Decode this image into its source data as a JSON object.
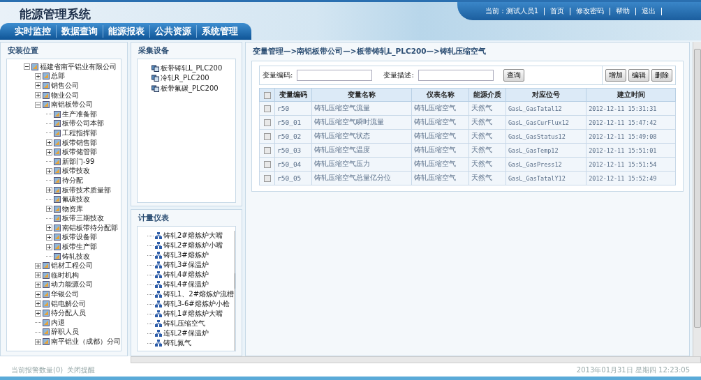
{
  "header": {
    "title": "能源管理系统",
    "user_label": "当前：",
    "user": "测试人员1",
    "links": [
      "首页",
      "修改密码",
      "帮助",
      "退出"
    ],
    "nav": [
      "实时监控",
      "数据查询",
      "能源报表",
      "公共资源",
      "系统管理"
    ]
  },
  "location_panel": {
    "title": "安装位置",
    "tree": [
      {
        "label": "福建省南平铝业有限公司",
        "kind": "branch",
        "expanded": true,
        "children": [
          {
            "label": "总部",
            "kind": "branch",
            "expanded": false
          },
          {
            "label": "销售公司",
            "kind": "branch",
            "expanded": false
          },
          {
            "label": "物业公司",
            "kind": "branch",
            "expanded": false
          },
          {
            "label": "南铝板带公司",
            "kind": "branch",
            "expanded": true,
            "children": [
              {
                "label": "生产准备部",
                "kind": "leaf"
              },
              {
                "label": "板带公司本部",
                "kind": "leaf"
              },
              {
                "label": "工程指挥部",
                "kind": "leaf"
              },
              {
                "label": "板带销售部",
                "kind": "branch",
                "expanded": false
              },
              {
                "label": "板带储管部",
                "kind": "branch",
                "expanded": false
              },
              {
                "label": "新部门-99",
                "kind": "leaf"
              },
              {
                "label": "板带技改",
                "kind": "branch",
                "expanded": false
              },
              {
                "label": "待分配",
                "kind": "leaf"
              },
              {
                "label": "板带技术质量部",
                "kind": "branch",
                "expanded": false
              },
              {
                "label": "氟碳技改",
                "kind": "leaf"
              },
              {
                "label": "物资库",
                "kind": "branch",
                "expanded": false
              },
              {
                "label": "板带三期技改",
                "kind": "leaf"
              },
              {
                "label": "南铝板带待分配部",
                "kind": "branch",
                "expanded": false
              },
              {
                "label": "板带设备部",
                "kind": "branch",
                "expanded": false
              },
              {
                "label": "板带生产部",
                "kind": "branch",
                "expanded": false
              },
              {
                "label": "铸轧技改",
                "kind": "leaf"
              }
            ]
          },
          {
            "label": "铝材工程公司",
            "kind": "branch",
            "expanded": false
          },
          {
            "label": "临时机构",
            "kind": "branch",
            "expanded": false
          },
          {
            "label": "动力能源公司",
            "kind": "branch",
            "expanded": false
          },
          {
            "label": "华银公司",
            "kind": "branch",
            "expanded": false
          },
          {
            "label": "铝电解公司",
            "kind": "branch",
            "expanded": false
          },
          {
            "label": "待分配人员",
            "kind": "branch",
            "expanded": false
          },
          {
            "label": "内退",
            "kind": "leaf"
          },
          {
            "label": "辞职人员",
            "kind": "leaf"
          },
          {
            "label": "南平铝业（成都）分司",
            "kind": "branch",
            "expanded": false
          }
        ]
      }
    ]
  },
  "device_panel": {
    "title": "采集设备",
    "items": [
      "板带铸轧L_PLC200",
      "冷轧R_PLC200",
      "板带氟碳_PLC200"
    ]
  },
  "meter_panel": {
    "title": "计量仪表",
    "items": [
      "铸轧2#熔炼炉大嘴",
      "铸轧2#熔炼炉小嘴",
      "铸轧3#熔炼炉",
      "铸轧3#保温炉",
      "铸轧4#熔炼炉",
      "铸轧4#保温炉",
      "铸轧1、2#熔炼炉流槽",
      "铸轧3-6#熔炼炉小枪",
      "铸轧1#熔炼炉大嘴",
      "铸轧压缩空气",
      "连轧2#保温炉",
      "铸轧氮气"
    ]
  },
  "main": {
    "breadcrumb": "变量管理—>南铝板带公司—>板带铸轧L_PLC200—>铸轧压缩空气",
    "search": {
      "code_label": "变量编码:",
      "desc_label": "变量描述:",
      "query_button": "查询"
    },
    "actions": [
      "增加",
      "编辑",
      "删除"
    ],
    "table": {
      "header_checked": false,
      "columns": [
        "变量编码",
        "变量名称",
        "仪表名称",
        "能源介质",
        "对应位号",
        "建立时间"
      ],
      "rows": [
        {
          "selected": false,
          "cells": [
            "r50",
            "铸轧压缩空气流量",
            "铸轧压缩空气",
            "天然气",
            "GasL_GasTatal12",
            "2012-12-11 15:31:31"
          ]
        },
        {
          "selected": false,
          "cells": [
            "r50_01",
            "铸轧压缩空气瞬时流量",
            "铸轧压缩空气",
            "天然气",
            "GasL_GasCurFlux12",
            "2012-12-11 15:47:42"
          ]
        },
        {
          "selected": false,
          "cells": [
            "r50_02",
            "铸轧压缩空气状态",
            "铸轧压缩空气",
            "天然气",
            "GasL_GasStatus12",
            "2012-12-11 15:49:08"
          ]
        },
        {
          "selected": false,
          "cells": [
            "r50_03",
            "铸轧压缩空气温度",
            "铸轧压缩空气",
            "天然气",
            "GasL_GasTemp12",
            "2012-12-11 15:51:01"
          ]
        },
        {
          "selected": false,
          "cells": [
            "r50_04",
            "铸轧压缩空气压力",
            "铸轧压缩空气",
            "天然气",
            "GasL_GasPress12",
            "2012-12-11 15:51:54"
          ]
        },
        {
          "selected": false,
          "cells": [
            "r50_05",
            "铸轧压缩空气总量亿分位",
            "铸轧压缩空气",
            "天然气",
            "GasL_GasTatalY12",
            "2012-12-11 15:52:49"
          ]
        }
      ]
    }
  },
  "status_bar": {
    "alarm": "当前报警数量(0)",
    "close_alert": "关闭提醒",
    "datetime": "2013年01月31日 星期四 12:23:05"
  }
}
